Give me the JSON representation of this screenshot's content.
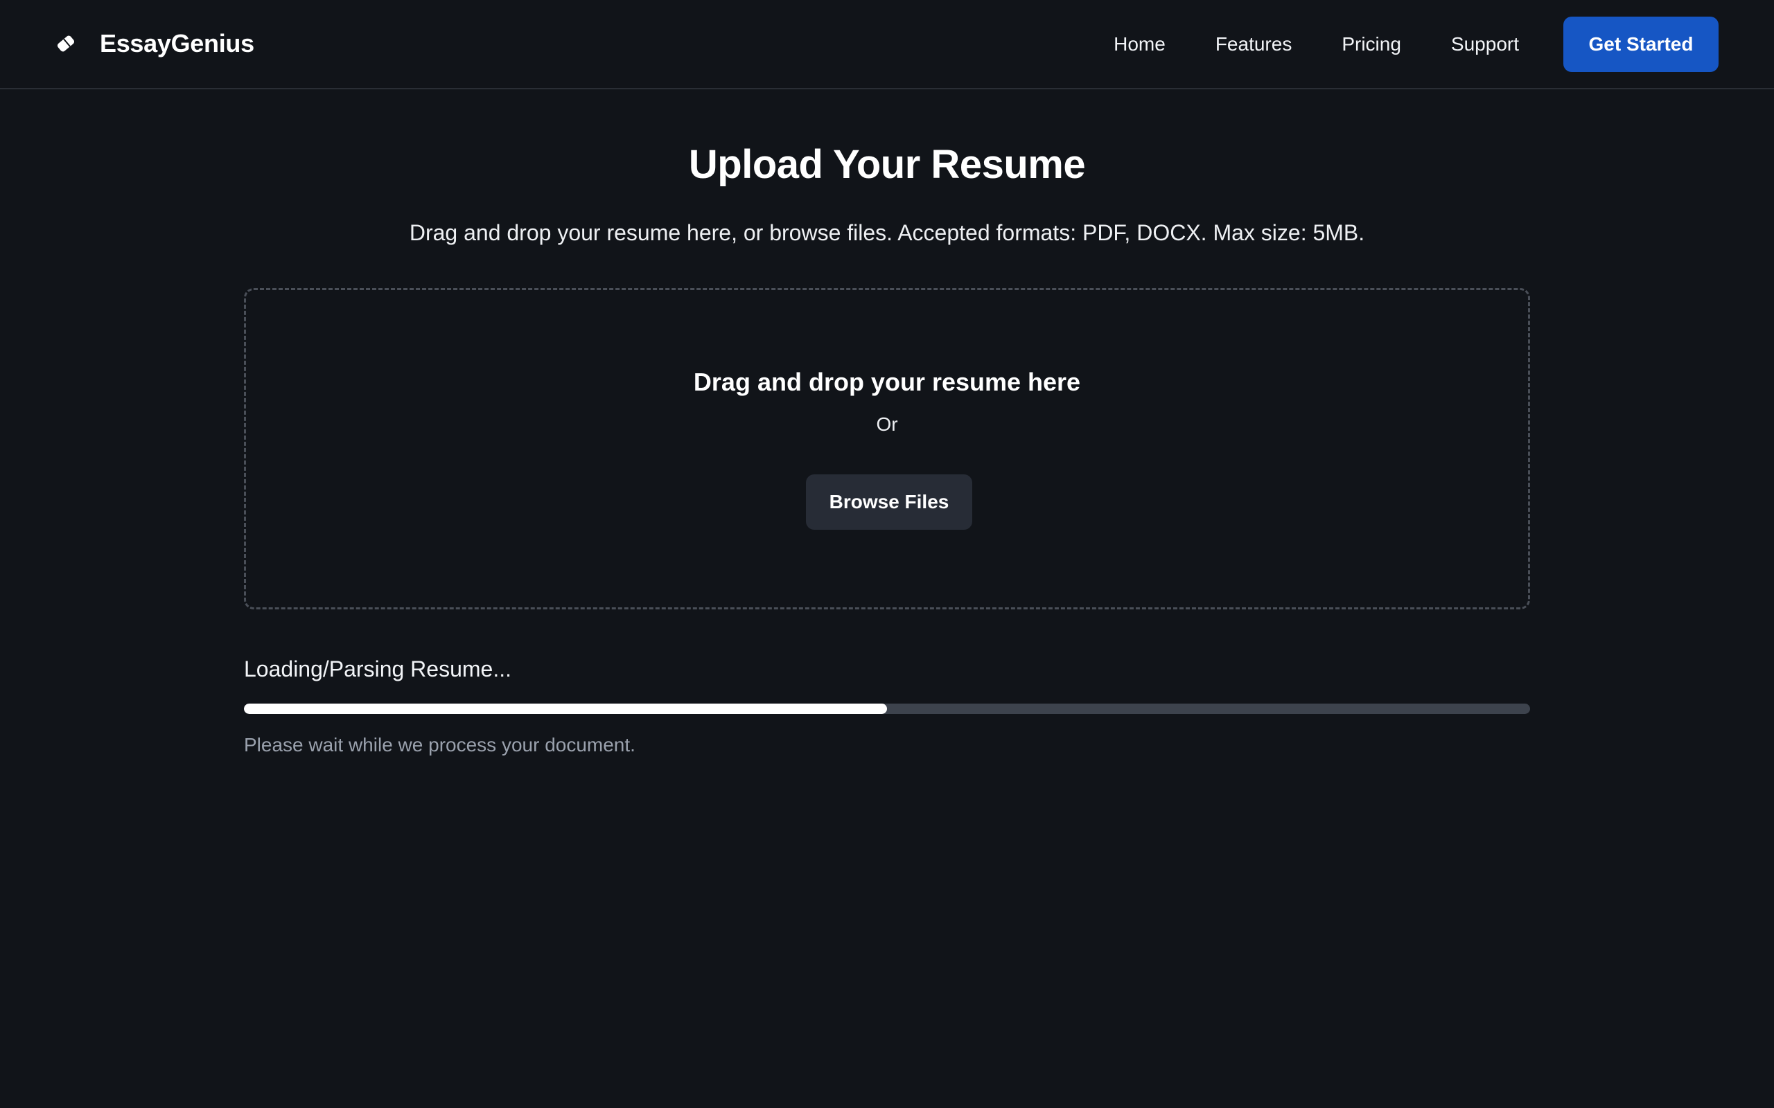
{
  "header": {
    "brand_name": "EssayGenius",
    "brand_icon": "eraser-icon",
    "nav": [
      {
        "label": "Home"
      },
      {
        "label": "Features"
      },
      {
        "label": "Pricing"
      },
      {
        "label": "Support"
      }
    ],
    "cta_label": "Get Started",
    "cta_color": "#1656c4"
  },
  "main": {
    "title": "Upload Your Resume",
    "subtitle": "Drag and drop your resume here, or browse files. Accepted formats: PDF, DOCX. Max size: 5MB.",
    "dropzone": {
      "title": "Drag and drop your resume here",
      "or_text": "Or",
      "browse_label": "Browse Files"
    },
    "upload_status": {
      "label": "Loading/Parsing Resume...",
      "progress_percent": 50,
      "hint": "Please wait while we process your document."
    }
  },
  "colors": {
    "background": "#111419",
    "progress_fill": "#ffffff",
    "progress_track": "#3d434d"
  }
}
